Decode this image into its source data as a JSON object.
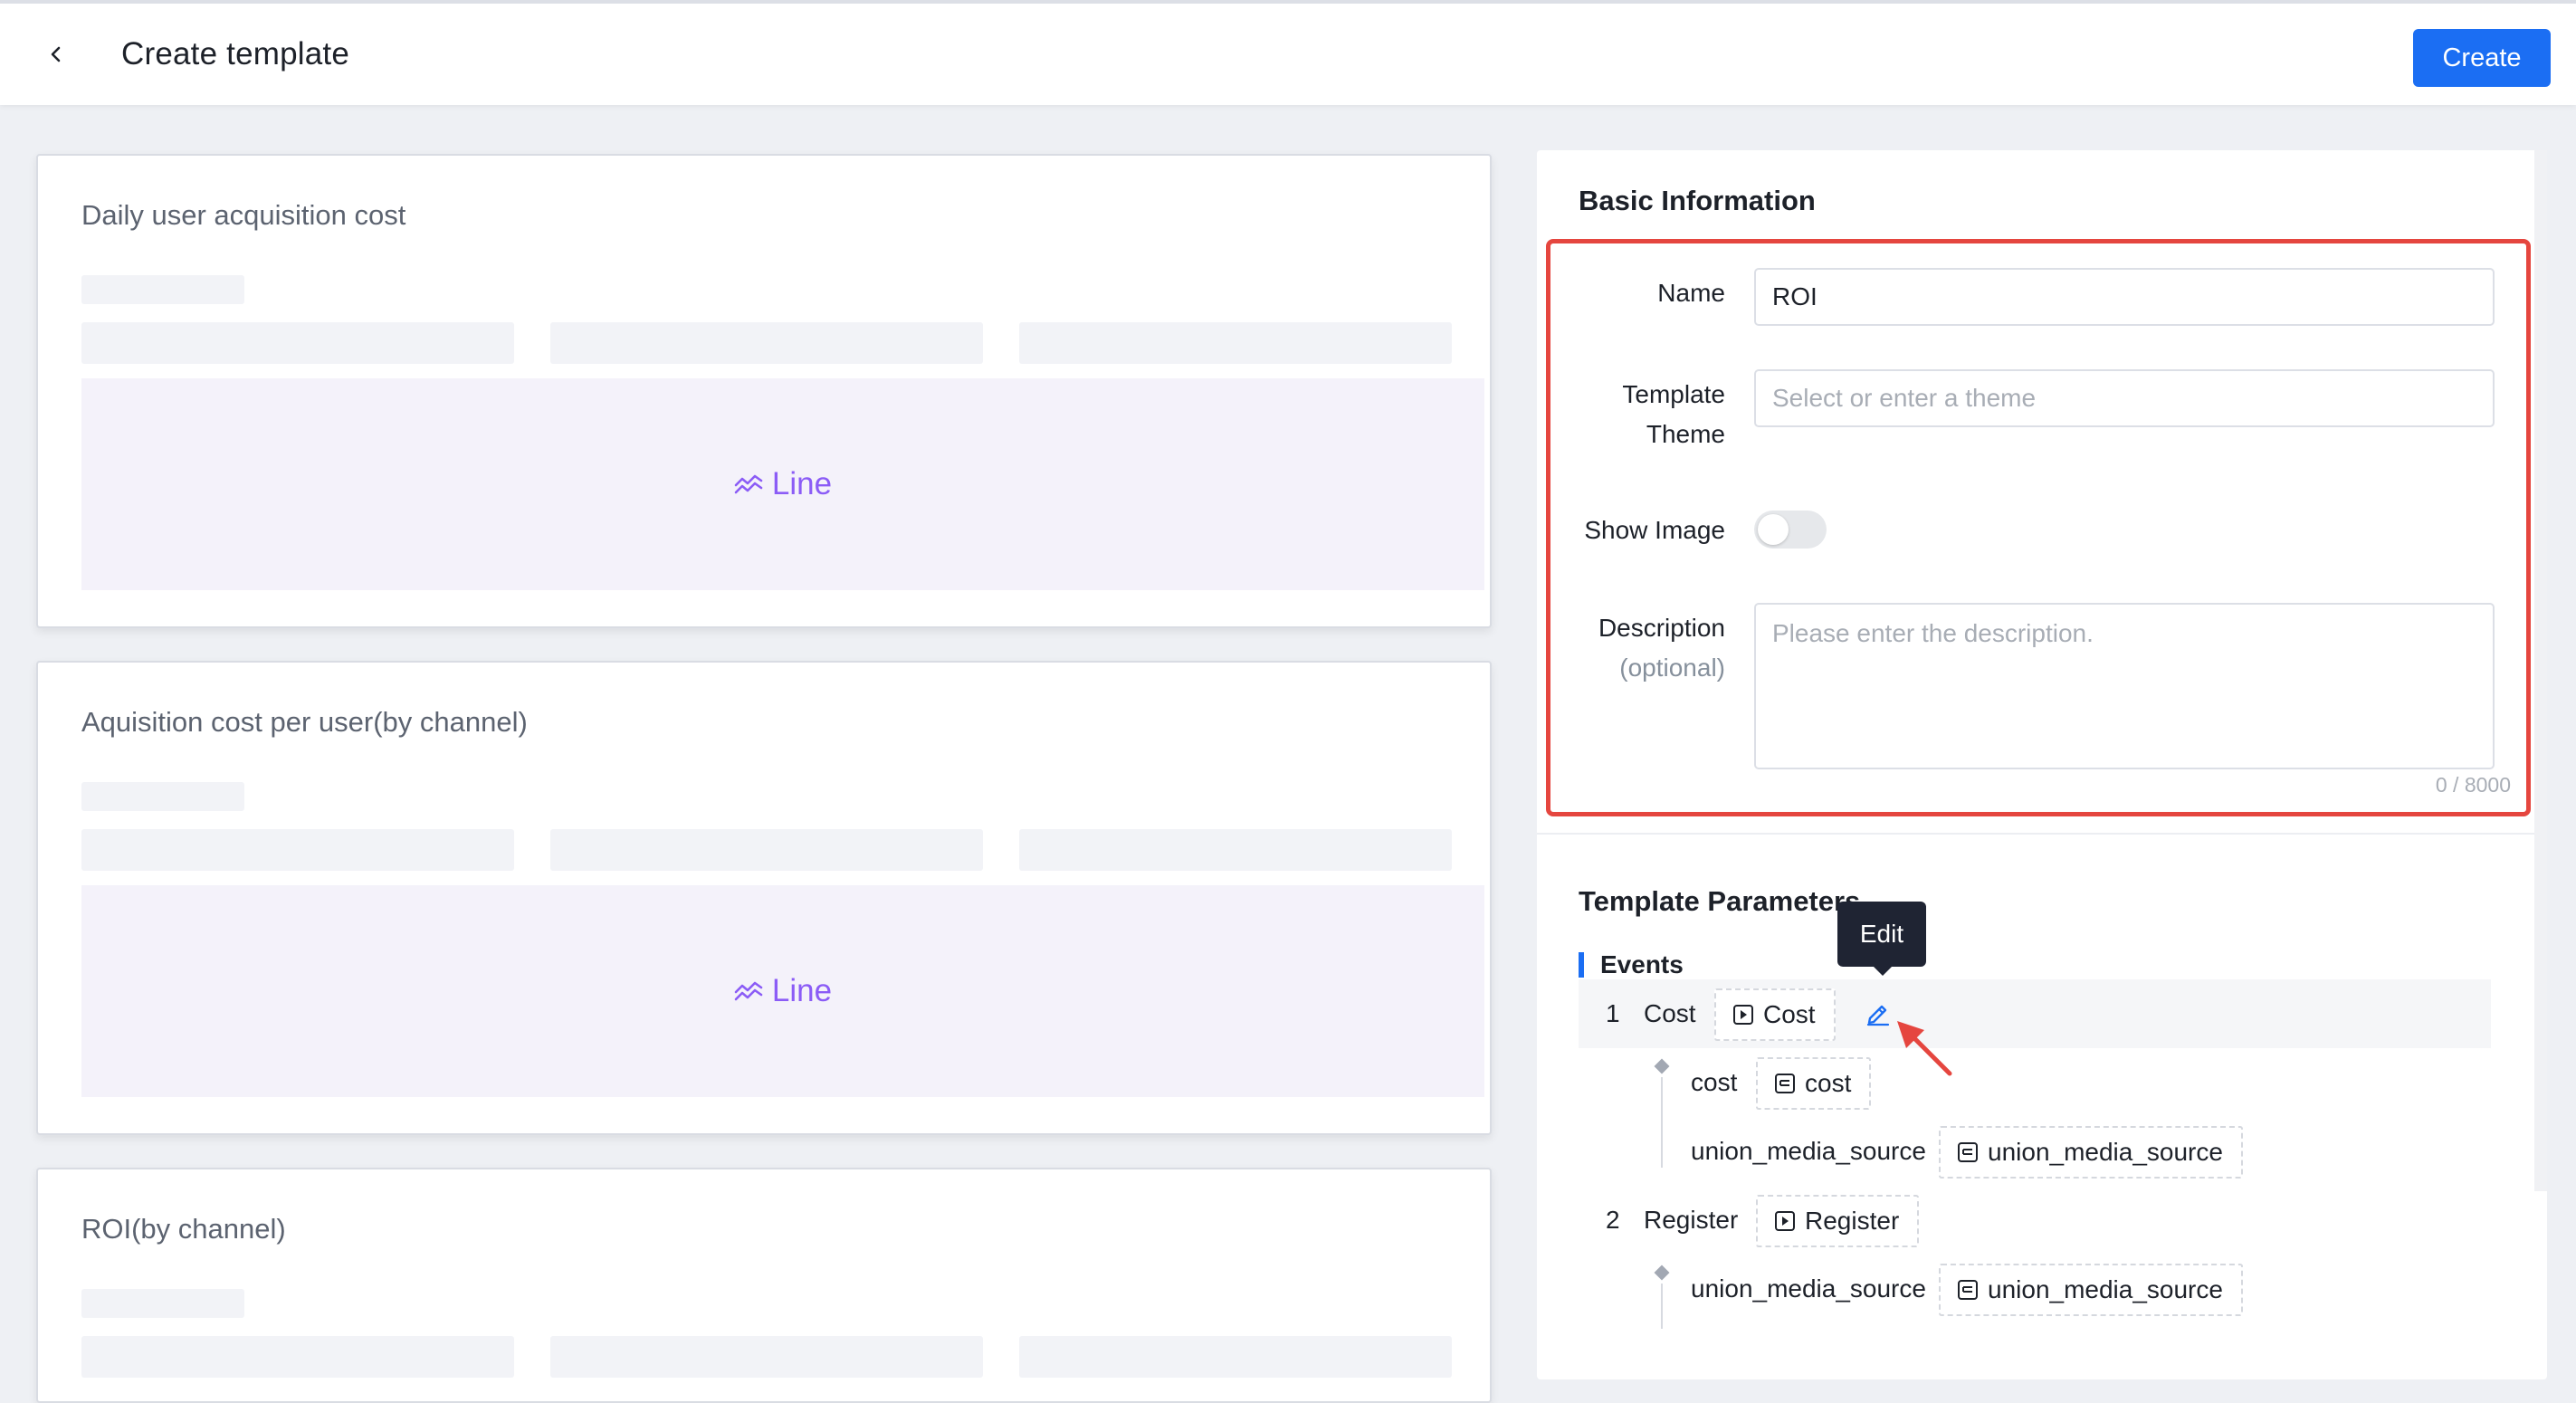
{
  "header": {
    "title": "Create template",
    "create_label": "Create"
  },
  "cards": [
    {
      "title": "Daily user acquisition cost",
      "chart_type_label": "Line"
    },
    {
      "title": "Aquisition cost per user(by channel)",
      "chart_type_label": "Line"
    },
    {
      "title": "ROI(by channel)"
    }
  ],
  "basic_info": {
    "title": "Basic Information",
    "name_label": "Name",
    "name_value": "ROI",
    "theme_label_line1": "Template",
    "theme_label_line2": "Theme",
    "theme_placeholder": "Select or enter a theme",
    "show_image_label": "Show Image",
    "show_image_on": false,
    "description_label": "Description",
    "description_sub": "(optional)",
    "description_placeholder": "Please enter the description.",
    "description_counter": "0 / 8000"
  },
  "template_params": {
    "title": "Template Parameters",
    "events_label": "Events",
    "tooltip": "Edit",
    "events": [
      {
        "index": "1",
        "name": "Cost",
        "chip": "Cost",
        "params": [
          {
            "name": "cost",
            "chip": "cost"
          },
          {
            "name": "union_media_source",
            "chip": "union_media_source"
          }
        ]
      },
      {
        "index": "2",
        "name": "Register",
        "chip": "Register",
        "params": [
          {
            "name": "union_media_source",
            "chip": "union_media_source"
          }
        ]
      }
    ]
  },
  "colors": {
    "primary": "#1b6ef3",
    "chart_accent": "#8b5cf6",
    "highlight": "#e5463f"
  }
}
